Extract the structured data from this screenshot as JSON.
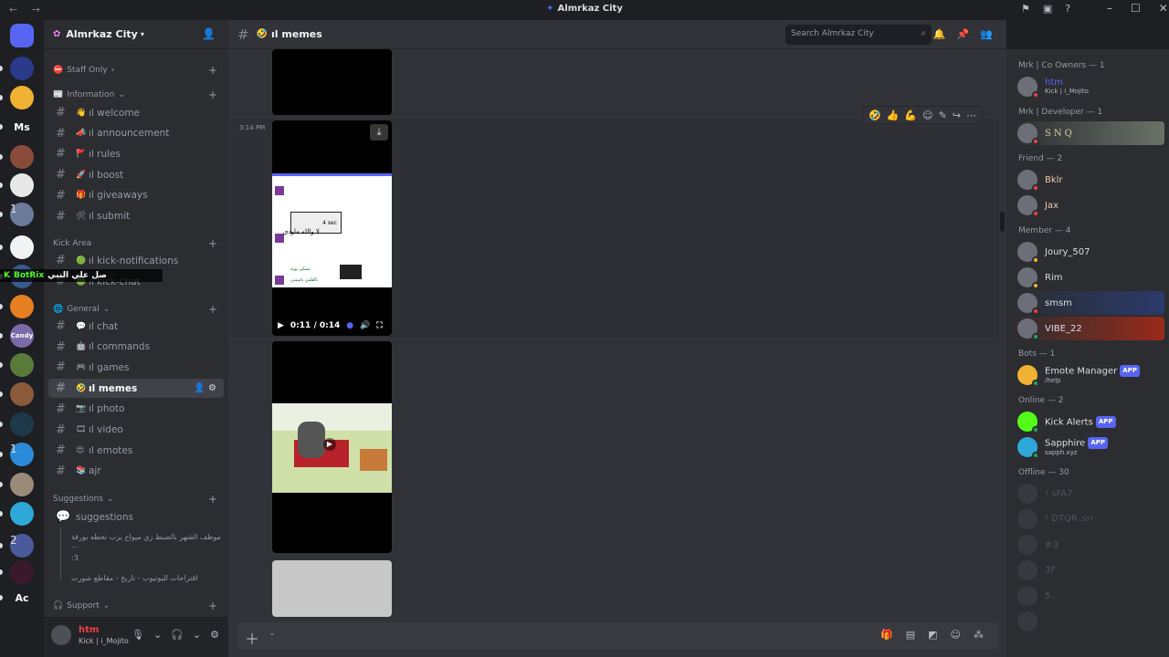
{
  "titlebar": {
    "nav": "← →",
    "title": "Almrkaz City",
    "icons": [
      "flag-icon",
      "inbox-icon",
      "help-icon"
    ],
    "window_controls": [
      "–",
      "☐",
      "✕"
    ]
  },
  "guilds": [
    {
      "label": "",
      "color": "#5865f2",
      "icon": "discord-home-icon"
    },
    {
      "label": "",
      "color": "#2c3a8c"
    },
    {
      "label": "",
      "color": "#f0b232"
    },
    {
      "label": "Ms",
      "color": "#1e1f22"
    },
    {
      "label": "",
      "color": "#8a4b3a"
    },
    {
      "label": "",
      "color": "#e8e8e8"
    },
    {
      "label": "",
      "color": "#6c7a9c",
      "badge": "1"
    },
    {
      "label": "",
      "color": "#f2f3f5"
    },
    {
      "label": "",
      "color": "#3a5a8a"
    },
    {
      "label": "",
      "color": "#e67e22"
    },
    {
      "label": "Candy",
      "color": "#7b6ba8"
    },
    {
      "label": "",
      "color": "#5a7a3a"
    },
    {
      "label": "",
      "color": "#8a5a3a"
    },
    {
      "label": "",
      "color": "#1e3a4a"
    },
    {
      "label": "",
      "color": "#2b8ad8",
      "badge": "1"
    },
    {
      "label": "",
      "color": "#9a8a7a"
    },
    {
      "label": "",
      "color": "#2ea8d8"
    },
    {
      "label": "",
      "color": "#4a5a9a",
      "badge": "2"
    },
    {
      "label": "",
      "color": "#3a1a2a"
    },
    {
      "label": "Ac",
      "color": "#1e1f22"
    }
  ],
  "server": {
    "name": "Almrkaz City",
    "icon": "server-icon"
  },
  "sidebar": {
    "categories": {
      "staff": "Staff Only",
      "information": "Information",
      "kick": "Kick Area",
      "general": "General",
      "suggestions": "Suggestions",
      "support": "Support"
    },
    "info_channels": [
      {
        "emoji": "👋",
        "name": "ıl welcome"
      },
      {
        "emoji": "📣",
        "name": "ıl announcement"
      },
      {
        "emoji": "🚩",
        "name": "ıl rules"
      },
      {
        "emoji": "🚀",
        "name": "ıl boost"
      },
      {
        "emoji": "🎁",
        "name": "ıl giveaways"
      },
      {
        "emoji": "🛠",
        "name": "ıl submit"
      }
    ],
    "kick_channels": [
      {
        "emoji": "🟢",
        "name": "ıl kick-notifications"
      },
      {
        "emoji": "🟢",
        "name": "ıl kick-chat"
      }
    ],
    "general_channels": [
      {
        "emoji": "💬",
        "name": "ıl chat"
      },
      {
        "emoji": "🤖",
        "name": "ıl commands"
      },
      {
        "emoji": "🎮",
        "name": "ıl games"
      },
      {
        "emoji": "🤣",
        "name": "ıl memes"
      },
      {
        "emoji": "📷",
        "name": "ıl photo"
      },
      {
        "emoji": "🎞",
        "name": "ıl video"
      },
      {
        "emoji": "😍",
        "name": "ıl emotes"
      },
      {
        "emoji": "📚",
        "name": "ajr"
      }
    ],
    "forum": "suggestions",
    "threads": [
      "موظف الشهر بالضبط زي ميواخ يرب تحطه بورقة ...",
      ":3",
      "اقتراحات لليوتيوب - تاريخ - مقاطع شورت"
    ],
    "overlay": {
      "name": "BotRix",
      "text": "صل علي النبي"
    }
  },
  "user": {
    "name": "htm",
    "status": "Kick | i_Mojito"
  },
  "chat": {
    "channel": "ıl memes",
    "search_placeholder": "Search Almrkaz City",
    "timestamp": "3:14 PM",
    "video": {
      "time": "0:11 / 0:14",
      "progress": 0.79
    },
    "video_texts": [
      "4 sec",
      "لا والله ماودي",
      "ممكن يوبة",
      "بالقلبي باسبني"
    ]
  },
  "members": {
    "groups": [
      {
        "title": "Mrk | Co Owners — 1",
        "items": [
          {
            "name": "htm",
            "sub": "Kick | i_Mojito",
            "color": "#5865f2",
            "status": "#f23f43"
          }
        ]
      },
      {
        "title": "Mrk | Developer — 1",
        "items": [
          {
            "name": "SNQ",
            "sub": "",
            "color": "#d4d0a0",
            "status": "#f23f43"
          }
        ]
      },
      {
        "title": "Friend — 2",
        "items": [
          {
            "name": "Bklr",
            "sub": "",
            "color": "#f2c8a8",
            "status": "#f23f43"
          },
          {
            "name": "Jax",
            "sub": "",
            "color": "#f2c8a8",
            "status": "#f23f43"
          }
        ]
      },
      {
        "title": "Member — 4",
        "items": [
          {
            "name": "Joury_507",
            "sub": "",
            "color": "#dbdee1",
            "status": "#f0b232"
          },
          {
            "name": "Rim",
            "sub": "",
            "color": "#dbdee1",
            "status": "#f0b232"
          },
          {
            "name": "smsm",
            "sub": "",
            "color": "#dbdee1",
            "status": "#f23f43"
          },
          {
            "name": "VIBE_22",
            "sub": "",
            "color": "#dbdee1",
            "status": "#23a55a"
          }
        ]
      },
      {
        "title": "Bots — 1",
        "items": [
          {
            "name": "Emote Manager",
            "sub": "/help",
            "color": "#dbdee1",
            "status": "#23a55a",
            "app": "APP"
          }
        ]
      },
      {
        "title": "Online — 2",
        "items": [
          {
            "name": "Kick Alerts",
            "sub": "",
            "color": "#dbdee1",
            "status": "#23a55a",
            "app": "APP"
          },
          {
            "name": "Sapphire",
            "sub": "sapph.xyz",
            "color": "#dbdee1",
            "status": "#23a55a",
            "app": "APP"
          }
        ]
      },
      {
        "title": "Offline — 30",
        "items": [
          {
            "name": "! sFA7",
            "sub": "",
            "color": "#949ba4",
            "status": ""
          },
          {
            "name": "! DTQR",
            "sub": "",
            "color": "#949ba4",
            "status": "",
            "tag": "507"
          },
          {
            "name": "#3",
            "sub": "",
            "color": "#949ba4",
            "status": ""
          },
          {
            "name": "3F",
            "sub": "",
            "color": "#949ba4",
            "status": ""
          },
          {
            "name": "5...",
            "sub": "",
            "color": "#949ba4",
            "status": ""
          },
          {
            "name": "",
            "sub": "",
            "color": "#949ba4",
            "status": ""
          }
        ]
      }
    ]
  }
}
